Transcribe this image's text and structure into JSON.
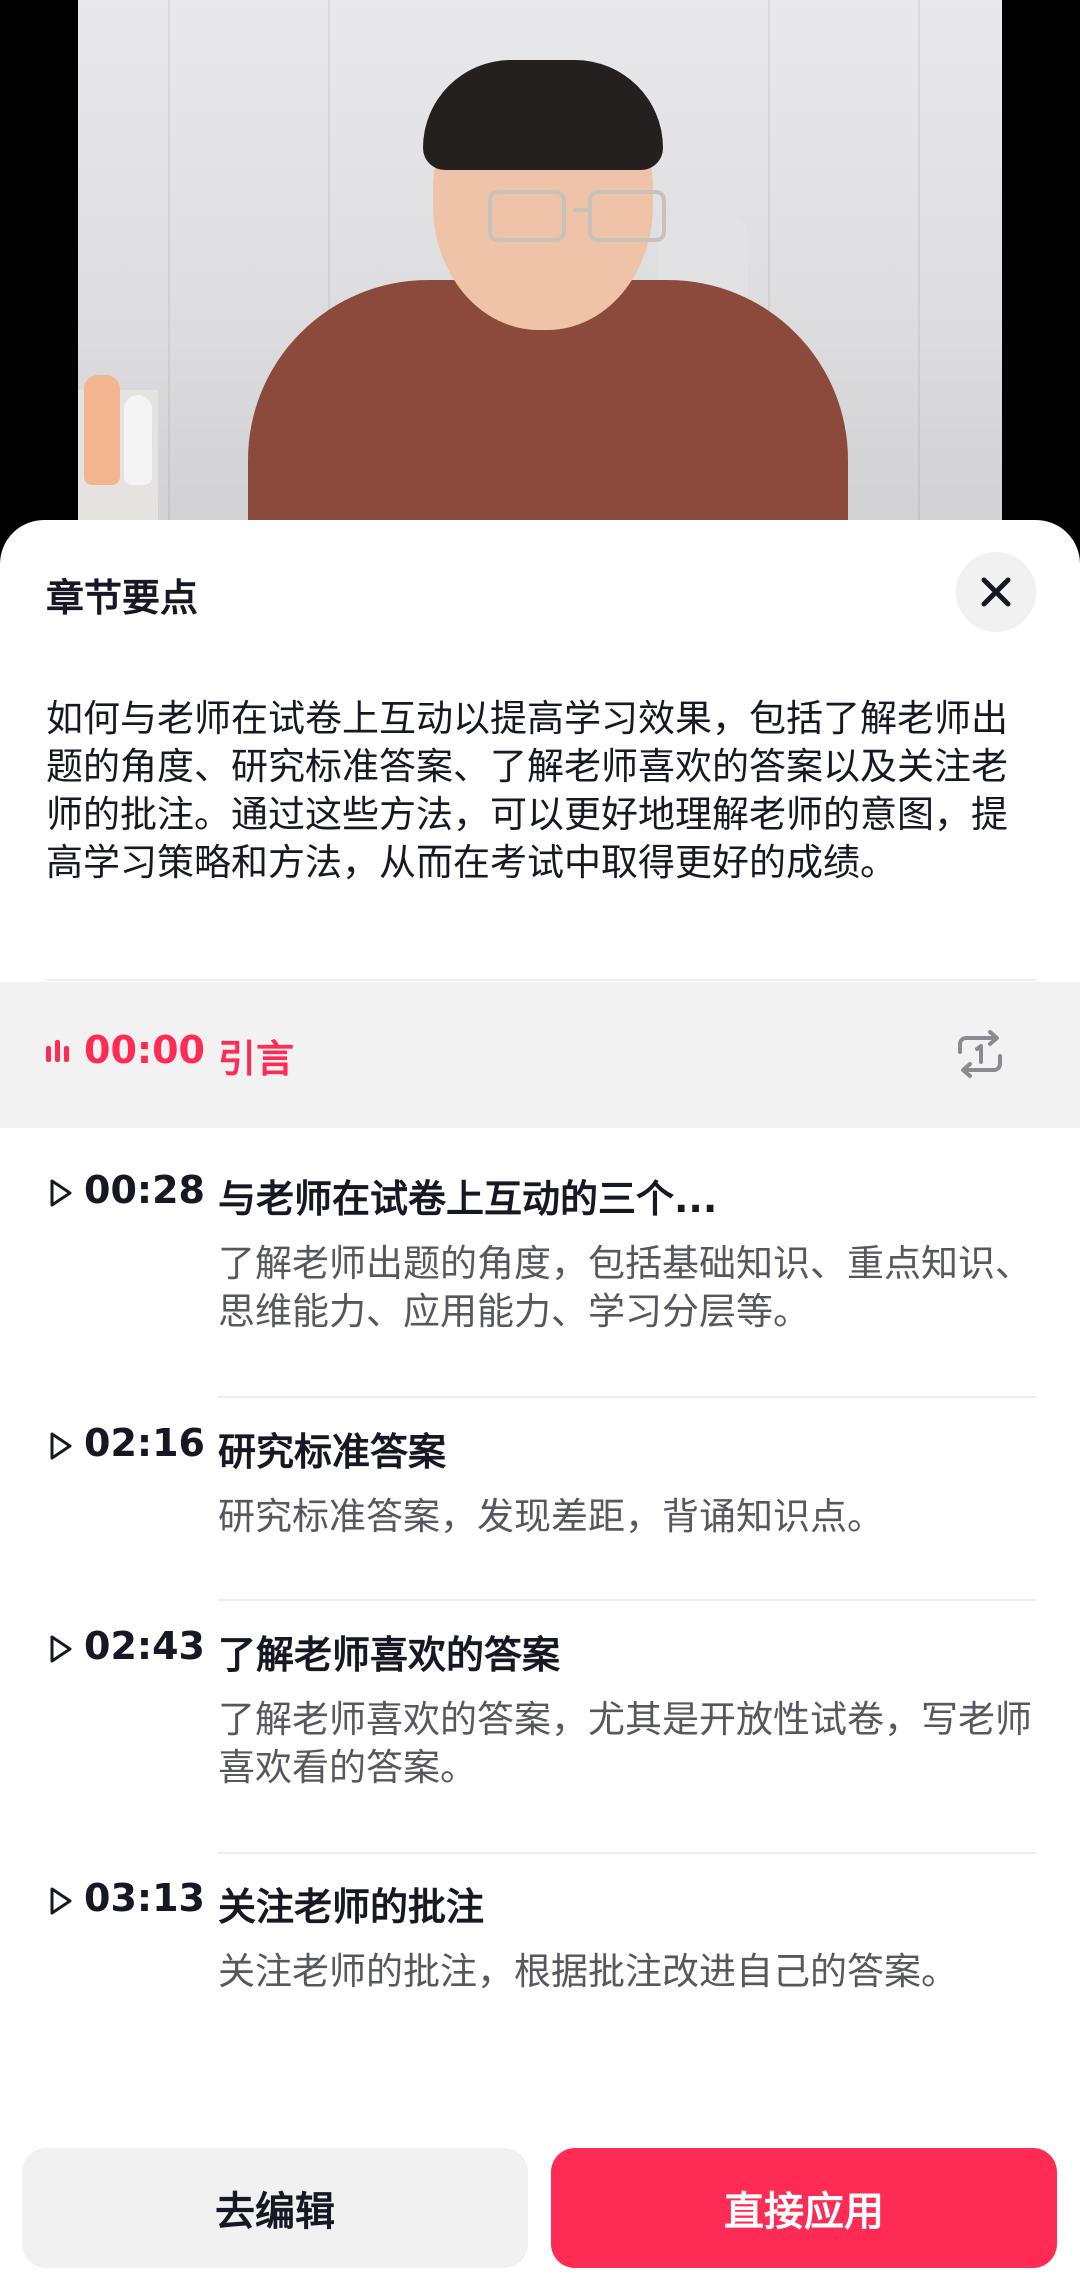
{
  "sheet": {
    "title": "章节要点",
    "summary": "如何与老师在试卷上互动以提高学习效果，包括了解老师出题的角度、研究标准答案、了解老师喜欢的答案以及关注老师的批注。通过这些方法，可以更好地理解老师的意图，提高学习策略和方法，从而在考试中取得更好的成绩。"
  },
  "current_chapter": {
    "time": "00:00",
    "title": "引言"
  },
  "chapters": [
    {
      "time": "00:28",
      "title": "与老师在试卷上互动的三个...",
      "desc": "了解老师出题的角度，包括基础知识、重点知识、思维能力、应用能力、学习分层等。"
    },
    {
      "time": "02:16",
      "title": "研究标准答案",
      "desc": "研究标准答案，发现差距，背诵知识点。"
    },
    {
      "time": "02:43",
      "title": "了解老师喜欢的答案",
      "desc": "了解老师喜欢的答案，尤其是开放性试卷，写老师喜欢看的答案。"
    },
    {
      "time": "03:13",
      "title": "关注老师的批注",
      "desc": "关注老师的批注，根据批注改进自己的答案。"
    }
  ],
  "actions": {
    "edit_label": "去编辑",
    "apply_label": "直接应用"
  },
  "colors": {
    "accent": "#fe2c55",
    "text_primary": "#161823",
    "text_secondary": "#57585f"
  }
}
